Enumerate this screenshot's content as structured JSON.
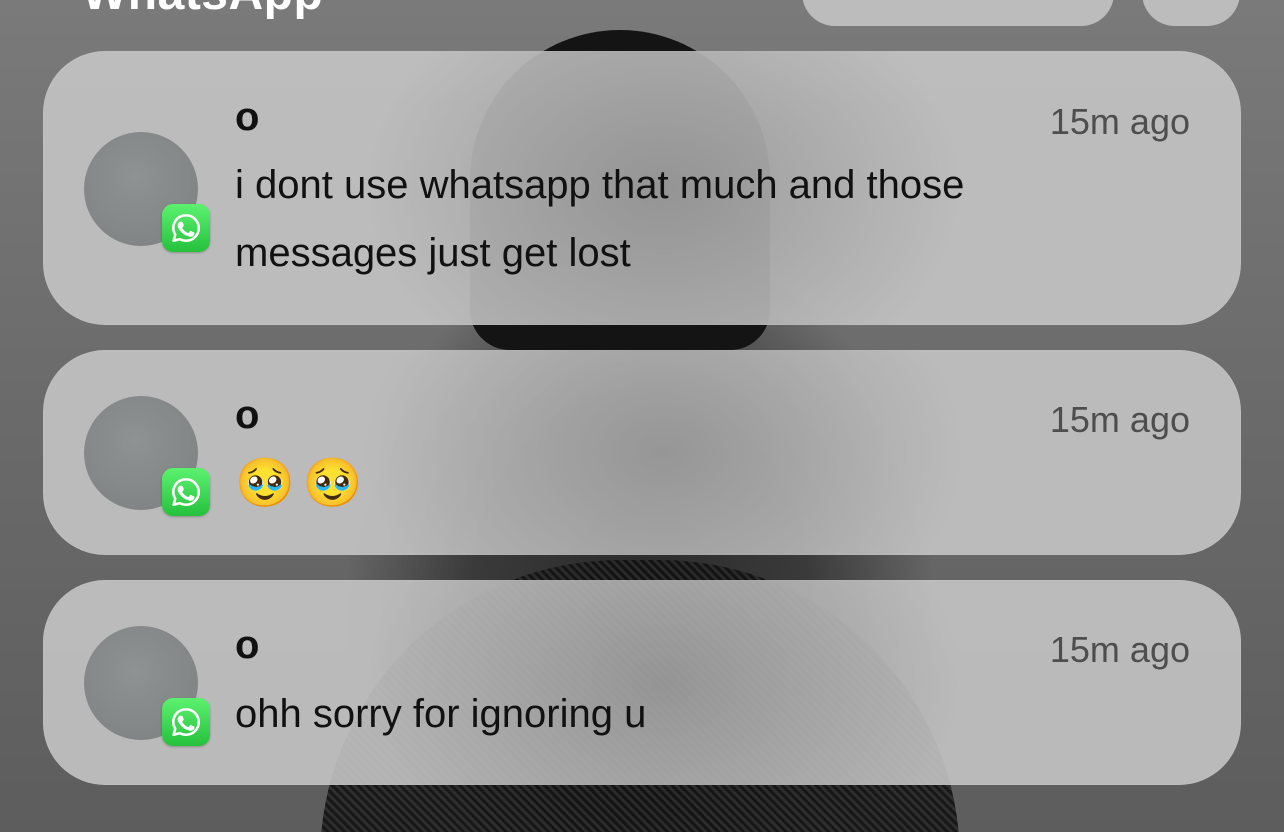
{
  "stack": {
    "title": "WhatsApp"
  },
  "notifications": [
    {
      "sender": "o",
      "time": "15m ago",
      "message": "i dont use whatsapp that much and those messages just get lost",
      "app_icon": "whatsapp-icon"
    },
    {
      "sender": "o",
      "time": "15m ago",
      "message": "🥹🥹",
      "app_icon": "whatsapp-icon"
    },
    {
      "sender": "o",
      "time": "15m ago",
      "message": "ohh sorry for ignoring u",
      "app_icon": "whatsapp-icon"
    }
  ],
  "colors": {
    "card_background": "#c4c4c4",
    "whatsapp_green": "#25c23c",
    "text_primary": "#111111",
    "text_secondary": "#4e4e4e"
  }
}
